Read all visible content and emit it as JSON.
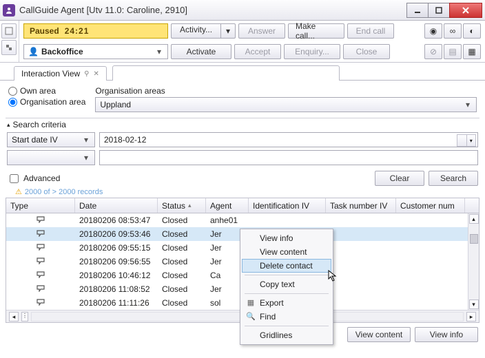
{
  "window": {
    "title": "CallGuide Agent [Utv 11.0: Caroline, 2910]"
  },
  "toolbar": {
    "status_label": "Paused",
    "status_time": "24:21",
    "activity": "Activity...",
    "answer": "Answer",
    "make_call": "Make call...",
    "end_call": "End call",
    "backoffice": "Backoffice",
    "activate": "Activate",
    "accept": "Accept",
    "enquiry": "Enquiry...",
    "close": "Close"
  },
  "tabs": {
    "interaction_view": "Interaction View"
  },
  "area": {
    "own_area": "Own area",
    "org_area": "Organisation area",
    "org_areas_label": "Organisation areas",
    "org_value": "Uppland"
  },
  "search": {
    "criteria_label": "Search criteria",
    "field1": "Start date IV",
    "value1": "2018-02-12",
    "advanced": "Advanced",
    "clear": "Clear",
    "search": "Search",
    "records_info": "2000 of > 2000 records"
  },
  "columns": {
    "type": "Type",
    "date": "Date",
    "status": "Status",
    "agent": "Agent",
    "ident": "Identification IV",
    "task": "Task number IV",
    "cust": "Customer num"
  },
  "rows": [
    {
      "date": "20180206 08:53:47",
      "status": "Closed",
      "agent": "anhe01"
    },
    {
      "date": "20180206 09:53:46",
      "status": "Closed",
      "agent": "Jer",
      "selected": true
    },
    {
      "date": "20180206 09:55:15",
      "status": "Closed",
      "agent": "Jer"
    },
    {
      "date": "20180206 09:56:55",
      "status": "Closed",
      "agent": "Jer"
    },
    {
      "date": "20180206 10:46:12",
      "status": "Closed",
      "agent": "Ca"
    },
    {
      "date": "20180206 11:08:52",
      "status": "Closed",
      "agent": "Jer"
    },
    {
      "date": "20180206 11:11:26",
      "status": "Closed",
      "agent": "sol"
    }
  ],
  "context_menu": {
    "view_info": "View info",
    "view_content": "View content",
    "delete_contact": "Delete contact",
    "copy_text": "Copy text",
    "export": "Export",
    "find": "Find",
    "gridlines": "Gridlines"
  },
  "bottom": {
    "view_content": "View content",
    "view_info": "View info"
  }
}
